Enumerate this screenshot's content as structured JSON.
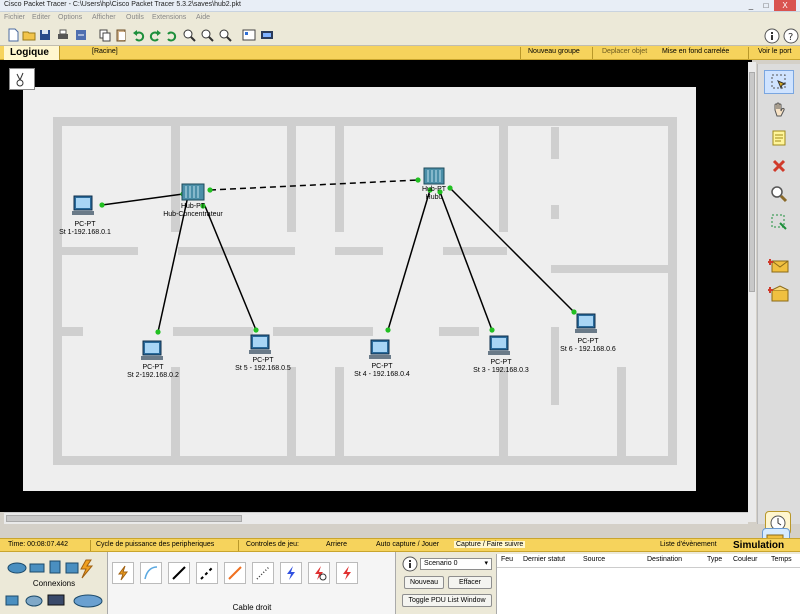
{
  "window": {
    "title": "Cisco Packet Tracer - C:\\Users\\hp\\Cisco Packet Tracer 5.3.2\\saves\\hub2.pkt",
    "min": "_",
    "max": "□",
    "close": "X"
  },
  "menu": [
    "Fichier",
    "Editer",
    "Options",
    "Afficher",
    "Outils",
    "Extensions",
    "Aide"
  ],
  "workspace_bar": {
    "tab": "Logique",
    "root": "[Racine]",
    "new_group": "Nouveau groupe",
    "move_object": "Deplacer objet",
    "background": "Mise en fond carrelée",
    "viewport": "Voir le port"
  },
  "devices": {
    "pc1": {
      "type": "PC-PT",
      "label": "St 1-192.168.0.1"
    },
    "pc2": {
      "type": "PC-PT",
      "label": "St 2-192.168.0.2"
    },
    "pc5": {
      "type": "PC-PT",
      "label": "St 5 - 192.168.0.5"
    },
    "pc4": {
      "type": "PC-PT",
      "label": "St 4 - 192.168.0.4"
    },
    "pc3": {
      "type": "PC-PT",
      "label": "St 3 - 192.168.0.3"
    },
    "pc6": {
      "type": "PC-PT",
      "label": "St 6 - 192.168.0.6"
    },
    "hub1": {
      "type": "Hub-PT",
      "label": "Hub-Concentrateur"
    },
    "hub2": {
      "type": "Hub-PT",
      "label": "Hub0"
    }
  },
  "timebar": {
    "time": "Time: 00:08:07.442",
    "power_cycle": "Cycle de puissance des peripheriques",
    "game_controls": "Controles de jeu:",
    "back": "Arriere",
    "auto_capture": "Auto capture / Jouer",
    "capture_forward": "Capture / Faire suivre",
    "event_list": "Liste d'évènement",
    "simulation": "Simulation"
  },
  "bottom": {
    "connections_label": "Connexions",
    "cable_label": "Cable droit",
    "scenario": "Scenario 0",
    "new_btn": "Nouveau",
    "delete_btn": "Effacer",
    "toggle_pdu": "Toggle PDU List Window",
    "pdu_columns": [
      "Feu",
      "Dernier statut",
      "Source",
      "Destination",
      "Type",
      "Couleur",
      "Temps"
    ]
  },
  "colors": {
    "accent_bar": "#f6d35c",
    "link_up": "#22c022",
    "canvas_bg": "#000000",
    "floor": "#eeeeee",
    "wall": "#cfcfcf"
  }
}
